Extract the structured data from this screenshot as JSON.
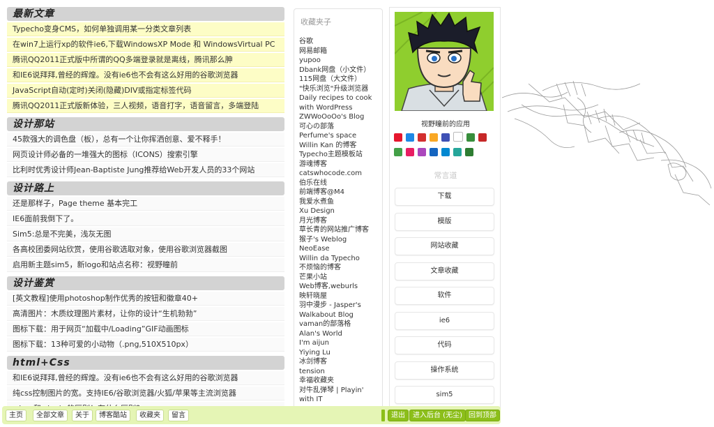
{
  "sections": [
    {
      "title": "最新文章",
      "highlight": true,
      "items": [
        "Typecho变身CMS，如何单独调用某一分类文章列表",
        "在win7上运行xp的软件ie6,下载WindowsXP Mode 和 WindowsVirtual PC",
        "腾讯QQ2011正式版中所谓的QQ多端登录就是离线，腾讯那么胂",
        "和IE6说拜拜,曾经的辉煌。没有ie6也不会有这么好用的谷歌浏览器",
        "JavaScript自动(定时)关闭(隐藏)DIV或指定标签代码",
        "腾讯QQ2011正式版新体验，三人视频，语音打字，语音留言，多端登陆"
      ]
    },
    {
      "title": "设计那站",
      "highlight": false,
      "items": [
        "45款强大的调色盘（板），总有一个让你挥洒创意、爱不释手！",
        "网页设计师必备的一堆强大的图标（ICONS）搜索引擎",
        "比利时优秀设计师Jean-Baptiste Jung推荐给Web开发人员的33个网站"
      ]
    },
    {
      "title": "设计路上",
      "highlight": false,
      "items": [
        "还是那样子，Page theme 基本完工",
        "IE6面前我倒下了。",
        "Sim5:总是不完美，浅灰无图",
        "各高校团委网站欣赏，使用谷歌选取对象，使用谷歌浏览器截图",
        "启用新主题sim5，新logo和站点名称：视野瞳前"
      ]
    },
    {
      "title": "设计鉴赏",
      "highlight": false,
      "items": [
        "[英文教程]使用photoshop制作优秀的按钮和徽章40+",
        "高清图片：木质纹理图片素材，让你的设计“生机勃勃”",
        "图标下载：用于网页“加载中/Loading”GIF动画图标",
        "图标下载：13种可爱的小动物（.png,510X510px）"
      ]
    },
    {
      "title": "html+Css",
      "highlight": false,
      "items": [
        "和IE6说拜拜,曾经的辉煌。没有ie6也不会有这么好用的谷歌浏览器",
        "纯css控制图片的宽。支持IE6/谷歌浏览器/火狐/苹果等主流浏览器",
        "<br>和<br />的区别！有什么区别？"
      ]
    }
  ],
  "bookmarks": {
    "title": "收藏夹子",
    "items": [
      "谷歌",
      "网易邮箱",
      "yupoo",
      "Dbank网盘（小文件）",
      "115网盘（大文件）",
      "\"快乐浏览\"升级浏览器",
      "Daily recipes to cook with WordPress",
      "ZWWoOoOo's Blog",
      "可心の部落",
      "Perfume's space",
      "Willin Kan 的博客",
      "Typecho主题模板站",
      "游魂博客",
      "catswhocode.com",
      "伯乐在线",
      "前端博客@M4",
      "我爱水煮鱼",
      "Xu Design",
      "月光博客",
      "草长青的网站推广博客",
      "猴子's Weblog",
      "NeoEase",
      "Willin da Typecho",
      "不烦恼的博客",
      "芒果小站",
      "Web博客,weburls",
      "映轩晓屋",
      "羽中漫步 - Jasper's Walkabout Blog",
      "vaman的部落格",
      "Alan's World",
      "I'm aijun",
      "Yiying Lu",
      "冰剑博客",
      "tension",
      "幸福收藏夹",
      "对牛乱弹琴 | Playin' with IT"
    ]
  },
  "profile": {
    "apps_label": "视野瞳前的应用",
    "app_icons": [
      {
        "icon": "weibo-icon",
        "color": "#e6162d"
      },
      {
        "icon": "photo-app-icon",
        "color": "#1e88e5"
      },
      {
        "icon": "douban-icon",
        "color": "#d32f2f"
      },
      {
        "icon": "qzone-icon",
        "color": "#f9a825"
      },
      {
        "icon": "picture-icon",
        "color": "#3f51b5"
      },
      {
        "icon": "blank-app-icon",
        "color": "#ffffff"
      },
      {
        "icon": "feed-icon",
        "color": "#388e3c"
      },
      {
        "icon": "music-icon",
        "color": "#c62828"
      },
      {
        "icon": "grid-app-icon",
        "color": "#43a047"
      },
      {
        "icon": "game-app-icon",
        "color": "#e91e63"
      },
      {
        "icon": "video-app-icon",
        "color": "#ab47bc"
      },
      {
        "icon": "bird-app-icon",
        "color": "#1565c0"
      },
      {
        "icon": "file-app-icon",
        "color": "#0288d1"
      },
      {
        "icon": "cloud-app-icon",
        "color": "#26a69a"
      },
      {
        "icon": "smile-app-icon",
        "color": "#2e7d32"
      }
    ],
    "frequent_label": "常言道",
    "frequent_items": [
      "下载",
      "模版",
      "网站收藏",
      "文章收藏",
      "软件",
      "ie6",
      "代码",
      "操作系统",
      "sim5"
    ]
  },
  "bottom_nav": {
    "left": [
      "主页",
      "全部文章",
      "关于",
      "博客酷站",
      "收藏夹",
      "留言"
    ],
    "right": [
      "退出",
      "进入后台 (无尘)",
      "回到顶部"
    ]
  },
  "colors": {
    "highlight": "#fdfdc6",
    "bar": "#e5f5b5",
    "accent": "#8cbf1a"
  }
}
